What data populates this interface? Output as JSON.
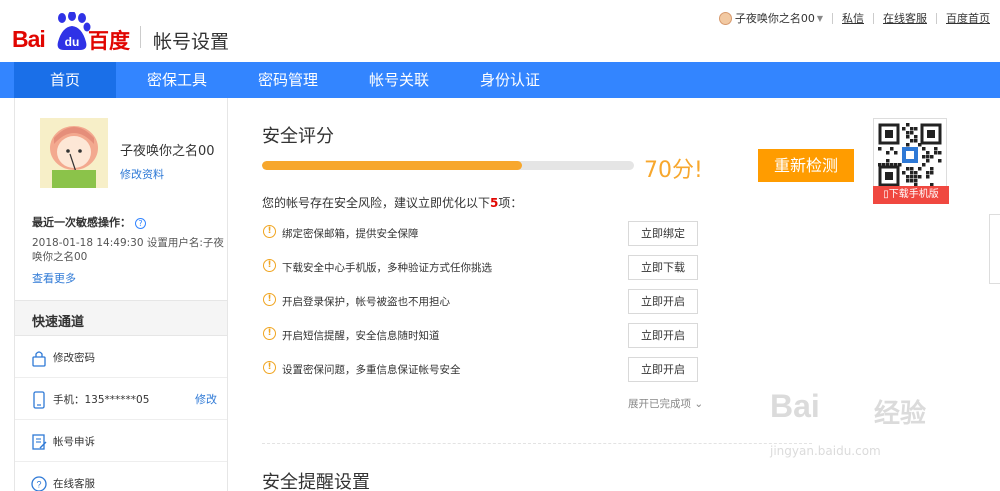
{
  "header": {
    "logo_text": "Bai",
    "logo_paw_text": "du",
    "logo_cn": "百度",
    "title": "帐号设置",
    "user_name": "子夜唤你之名00",
    "links": [
      "私信",
      "在线客服",
      "百度首页"
    ]
  },
  "nav": {
    "items": [
      "首页",
      "密保工具",
      "密码管理",
      "帐号关联",
      "身份认证"
    ]
  },
  "sidebar": {
    "name": "子夜唤你之名00",
    "edit_profile": "修改资料",
    "last_op_title": "最近一次敏感操作：",
    "last_op_text": "2018-01-18 14:49:30  设置用户名:子夜唤你之名00",
    "see_more": "查看更多",
    "quick_title": "快速通道",
    "quick_items": [
      {
        "label": "修改密码",
        "action": ""
      },
      {
        "label": "手机：135******05",
        "action": "修改"
      },
      {
        "label": "帐号申诉",
        "action": ""
      },
      {
        "label": "在线客服",
        "action": ""
      }
    ]
  },
  "main": {
    "section_title": "安全评分",
    "score_percent": 70,
    "score_text": "70分!",
    "recheck": "重新检测",
    "risk_prefix": "您的帐号存在安全风险，建议立即优化以下",
    "risk_count": "5",
    "risk_suffix": "项：",
    "tasks": [
      {
        "label": "绑定密保邮箱，提供安全保障",
        "button": "立即绑定"
      },
      {
        "label": "下载安全中心手机版，多种验证方式任你挑选",
        "button": "立即下载"
      },
      {
        "label": "开启登录保护，帐号被盗也不用担心",
        "button": "立即开启"
      },
      {
        "label": "开启短信提醒，安全信息随时知道",
        "button": "立即开启"
      },
      {
        "label": "设置密保问题，多重信息保证帐号安全",
        "button": "立即开启"
      }
    ],
    "expand": "展开已完成项",
    "section2_title": "安全提醒设置"
  },
  "qr": {
    "download": "下载手机版"
  },
  "watermark": {
    "text": "Bai",
    "cn": "经验",
    "url": "jingyan.baidu.com"
  }
}
